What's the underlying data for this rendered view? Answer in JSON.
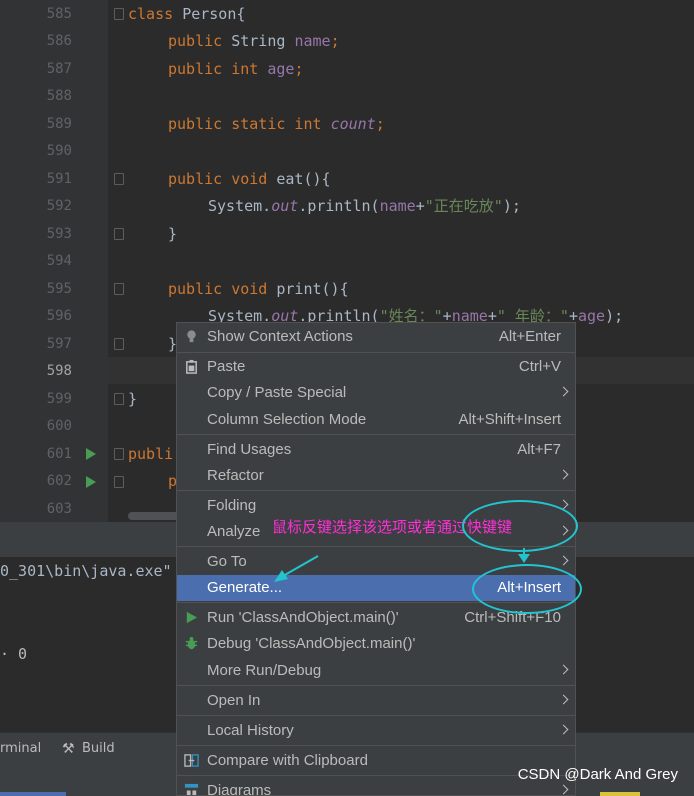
{
  "editor": {
    "line_numbers": [
      "585",
      "586",
      "587",
      "588",
      "589",
      "590",
      "591",
      "592",
      "593",
      "594",
      "595",
      "596",
      "597",
      "598",
      "599",
      "600",
      "601",
      "602",
      "603"
    ],
    "code": {
      "l585_kw": "class ",
      "l585_rest": "Person{",
      "l586_kw": "public ",
      "l586_type": "String ",
      "l586_fld": "name",
      "l586_end": ";",
      "l587_kw": "public int ",
      "l587_fld": "age",
      "l587_end": ";",
      "l589_kw": "public static int ",
      "l589_fld": "count",
      "l589_end": ";",
      "l591_kw": "public void ",
      "l591_rest": "eat(){",
      "l592_a": "System.",
      "l592_out": "out",
      "l592_b": ".println(",
      "l592_fld": "name",
      "l592_c": "+",
      "l592_str": "\"正在吃放\"",
      "l592_end": ");",
      "l593": "}",
      "l595_kw": "public void ",
      "l595_rest": "print(){",
      "l596_a": "System.",
      "l596_out": "out",
      "l596_b": ".println(",
      "l596_str1": "\"姓名：\"",
      "l596_c": "+",
      "l596_fld1": "name",
      "l596_d": "+",
      "l596_str2": "\" 年龄：\"",
      "l596_e": "+",
      "l596_fld2": "age",
      "l596_end": ");",
      "l597": "}",
      "l599": "}",
      "l601": "publi",
      "l602": "p"
    }
  },
  "bottom": {
    "path": "0_301\\bin\\java.exe\"",
    "value": "· 0"
  },
  "toolbar": {
    "terminal": "rminal",
    "build": "Build"
  },
  "context_menu": {
    "items": [
      {
        "label": "Show Context Actions",
        "shortcut": "Alt+Enter",
        "icon": "lightbulb-icon"
      },
      {
        "label": "Paste",
        "shortcut": "Ctrl+V",
        "icon": "clipboard-icon"
      },
      {
        "label": "Copy / Paste Special",
        "submenu": true
      },
      {
        "label": "Column Selection Mode",
        "shortcut": "Alt+Shift+Insert"
      },
      {
        "label": "Find Usages",
        "shortcut": "Alt+F7"
      },
      {
        "label": "Refactor",
        "submenu": true
      },
      {
        "label": "Folding",
        "submenu": true
      },
      {
        "label": "Analyze",
        "submenu": true
      },
      {
        "label": "Go To",
        "submenu": true
      },
      {
        "label": "Generate...",
        "shortcut": "Alt+Insert",
        "selected": true
      },
      {
        "label": "Run 'ClassAndObject.main()'",
        "shortcut": "Ctrl+Shift+F10",
        "icon": "run-icon"
      },
      {
        "label": "Debug 'ClassAndObject.main()'",
        "icon": "debug-icon"
      },
      {
        "label": "More Run/Debug",
        "submenu": true
      },
      {
        "label": "Open In",
        "submenu": true
      },
      {
        "label": "Local History",
        "submenu": true
      },
      {
        "label": "Compare with Clipboard",
        "icon": "compare-icon"
      },
      {
        "label": "Diagrams",
        "submenu": true,
        "icon": "diagram-icon"
      }
    ]
  },
  "annotation": {
    "text": "鼠标反键选择该选项或者通过快键键"
  },
  "watermark": "CSDN @Dark And Grey",
  "colors": {
    "selection": "#4b6eaf",
    "annotation_text": "#ff2fd6",
    "annotation_shape": "#22c4cf",
    "keyword": "#cc7832",
    "field": "#9876aa",
    "string": "#6a8759"
  }
}
